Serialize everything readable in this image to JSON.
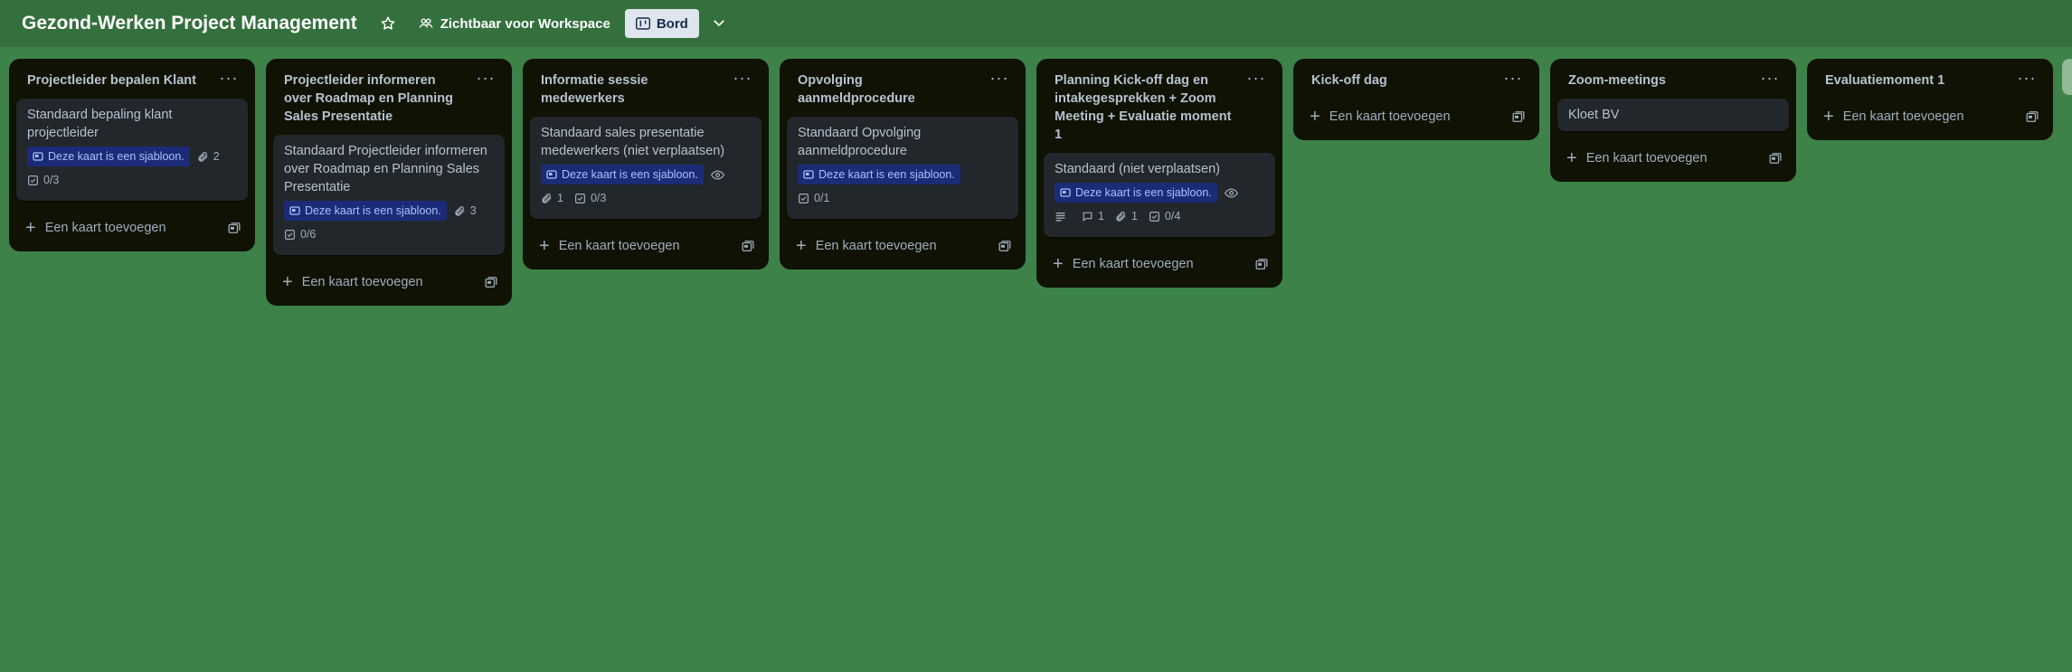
{
  "header": {
    "board_title": "Gezond-Werken Project Management",
    "visibility_label": "Zichtbaar voor Workspace",
    "view_label": "Bord"
  },
  "lists": [
    {
      "title": "Projectleider bepalen Klant",
      "cards": [
        {
          "title": "Standaard bepaling klant projectleider",
          "template": "Deze kaart is een sjabloon.",
          "attachments": "2",
          "checklist": "0/3"
        }
      ],
      "add_label": "Een kaart toevoegen"
    },
    {
      "title": "Projectleider informeren over Roadmap en Planning Sales Presentatie",
      "cards": [
        {
          "title": "Standaard Projectleider informeren over Roadmap en Planning Sales Presentatie",
          "template": "Deze kaart is een sjabloon.",
          "attachments": "3",
          "checklist": "0/6"
        }
      ],
      "add_label": "Een kaart toevoegen"
    },
    {
      "title": "Informatie sessie medewerkers",
      "cards": [
        {
          "title": "Standaard sales presentatie medewerkers (niet verplaatsen)",
          "template": "Deze kaart is een sjabloon.",
          "attachments": "1",
          "checklist": "0/3"
        }
      ],
      "add_label": "Een kaart toevoegen"
    },
    {
      "title": "Opvolging aanmeldprocedure",
      "cards": [
        {
          "title": "Standaard Opvolging aanmeldprocedure",
          "template": "Deze kaart is een sjabloon.",
          "checklist": "0/1"
        }
      ],
      "add_label": "Een kaart toevoegen"
    },
    {
      "title": "Planning Kick-off dag en intakegesprekken + Zoom Meeting + Evaluatie moment 1",
      "cards": [
        {
          "title": "Standaard (niet verplaatsen)",
          "template": "Deze kaart is een sjabloon.",
          "comments": "1",
          "attachments": "1",
          "checklist": "0/4"
        }
      ],
      "add_label": "Een kaart toevoegen"
    },
    {
      "title": "Kick-off dag",
      "cards": [],
      "add_label": "Een kaart toevoegen"
    },
    {
      "title": "Zoom-meetings",
      "cards": [
        {
          "title": "Kloet BV"
        }
      ],
      "add_label": "Een kaart toevoegen"
    },
    {
      "title": "Evaluatiemoment 1",
      "cards": [],
      "add_label": "Een kaart toevoegen"
    }
  ]
}
